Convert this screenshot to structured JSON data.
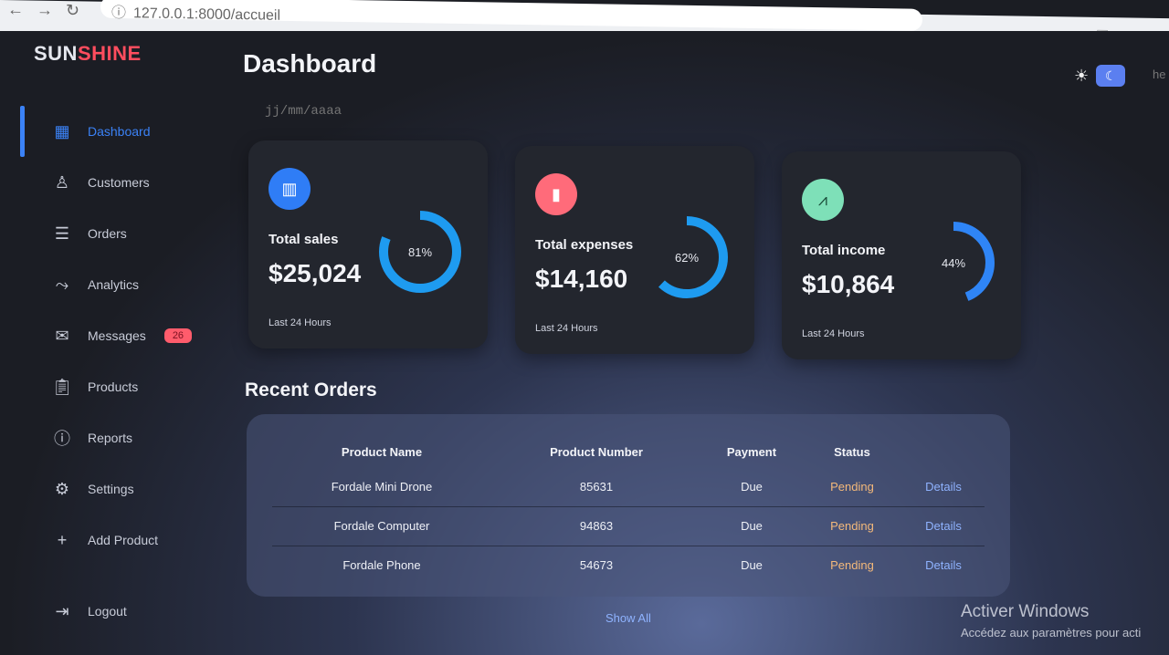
{
  "browser": {
    "url": "127.0.0.1:8000/accueil"
  },
  "sidebar": {
    "logo_part1": "SUN",
    "logo_part2": "SHINE",
    "items": [
      {
        "label": "Dashboard",
        "icon": "grid-icon"
      },
      {
        "label": "Customers",
        "icon": "user-icon"
      },
      {
        "label": "Orders",
        "icon": "receipt-icon"
      },
      {
        "label": "Analytics",
        "icon": "analytics-icon"
      },
      {
        "label": "Messages",
        "icon": "mail-icon",
        "badge": "26"
      },
      {
        "label": "Products",
        "icon": "clipboard-icon"
      },
      {
        "label": "Reports",
        "icon": "alert-icon"
      },
      {
        "label": "Settings",
        "icon": "gear-icon"
      },
      {
        "label": "Add Product",
        "icon": "plus-icon"
      }
    ],
    "logout": "Logout"
  },
  "header": {
    "title": "Dashboard",
    "date_placeholder": "jj/mm/aaaa",
    "profile_fragment": "he"
  },
  "cards": [
    {
      "label": "Total sales",
      "value": "$25,024",
      "percent_label": "81%",
      "percent": 81,
      "foot": "Last 24 Hours",
      "icon_color": "#2f7df6",
      "ring_color": "#1e9bf0"
    },
    {
      "label": "Total expenses",
      "value": "$14,160",
      "percent_label": "62%",
      "percent": 62,
      "foot": "Last 24 Hours",
      "icon_color": "#ff6b7a",
      "ring_color": "#1e9bf0"
    },
    {
      "label": "Total income",
      "value": "$10,864",
      "percent_label": "44%",
      "percent": 44,
      "foot": "Last 24 Hours",
      "icon_color": "#7ee0b8",
      "ring_color": "#2f85f6"
    }
  ],
  "recent_orders": {
    "title": "Recent Orders",
    "headers": [
      "Product Name",
      "Product Number",
      "Payment",
      "Status",
      ""
    ],
    "rows": [
      {
        "name": "Fordale Mini Drone",
        "number": "85631",
        "payment": "Due",
        "status": "Pending",
        "action": "Details"
      },
      {
        "name": "Fordale Computer",
        "number": "94863",
        "payment": "Due",
        "status": "Pending",
        "action": "Details"
      },
      {
        "name": "Fordale Phone",
        "number": "54673",
        "payment": "Due",
        "status": "Pending",
        "action": "Details"
      }
    ],
    "show_all": "Show All"
  },
  "watermark": {
    "line1": "Activer Windows",
    "line2": "Accédez aux paramètres pour acti"
  }
}
